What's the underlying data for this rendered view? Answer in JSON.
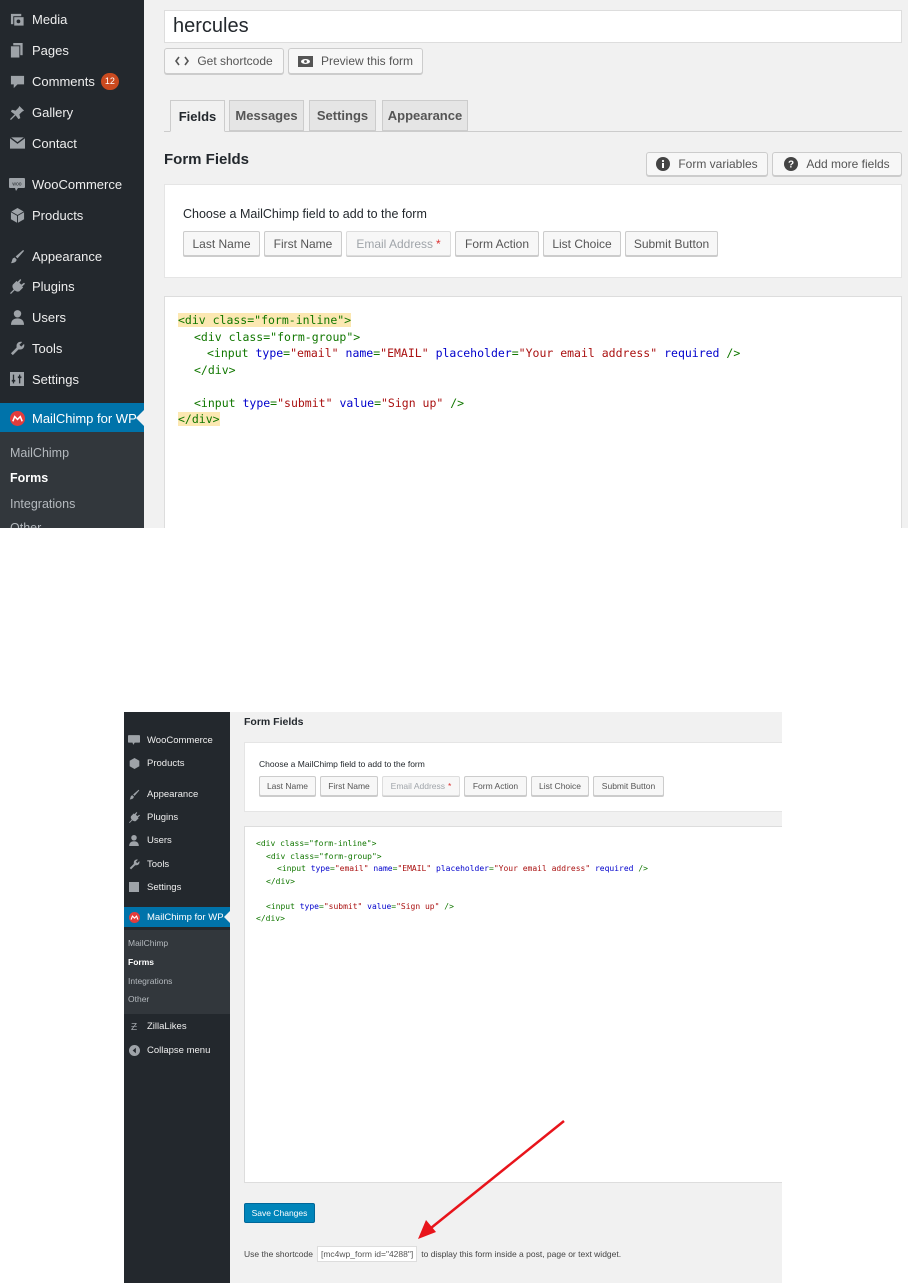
{
  "colors": {
    "sidebar_bg": "#23282d",
    "active_menu": "#0073aa",
    "primary_button": "#0085ba",
    "badge": "#ca4a1f",
    "arrow": "#e8141b"
  },
  "sidebar": {
    "items": [
      {
        "label": "Media",
        "icon": "media-icon"
      },
      {
        "label": "Pages",
        "icon": "pages-icon"
      },
      {
        "label": "Comments",
        "icon": "comments-icon",
        "badge": "12"
      },
      {
        "label": "Gallery",
        "icon": "pin-icon"
      },
      {
        "label": "Contact",
        "icon": "mail-icon"
      },
      {
        "label": "WooCommerce",
        "icon": "woo-icon"
      },
      {
        "label": "Products",
        "icon": "cube-icon"
      },
      {
        "label": "Appearance",
        "icon": "brush-icon"
      },
      {
        "label": "Plugins",
        "icon": "plug-icon"
      },
      {
        "label": "Users",
        "icon": "user-icon"
      },
      {
        "label": "Tools",
        "icon": "wrench-icon"
      },
      {
        "label": "Settings",
        "icon": "settings-icon"
      },
      {
        "label": "MailChimp for WP",
        "icon": "mailchimp-icon"
      }
    ],
    "submenu": [
      "MailChimp",
      "Forms",
      "Integrations",
      "Other"
    ],
    "extra": [
      {
        "label": "ZillaLikes",
        "icon": "zilla-icon"
      },
      {
        "label": "Collapse menu",
        "icon": "collapse-icon"
      }
    ]
  },
  "form": {
    "title": "hercules",
    "get_shortcode": "Get shortcode",
    "preview": "Preview this form"
  },
  "tabs": [
    "Fields",
    "Messages",
    "Settings",
    "Appearance"
  ],
  "fields_section": {
    "title": "Form Fields",
    "form_variables": "Form variables",
    "add_more_fields": "Add more fields",
    "choose_label": "Choose a MailChimp field to add to the form",
    "buttons": [
      "Last Name",
      "First Name",
      "Email Address",
      "Form Action",
      "List Choice",
      "Submit Button"
    ],
    "required_mark": "*"
  },
  "code": {
    "open_div": "<div class=\"form-inline\">",
    "open_group": "<div class=\"form-group\">",
    "input_email": "<input type=\"email\" name=\"EMAIL\" placeholder=\"Your email address\" required />",
    "close_group": "</div>",
    "input_submit": "<input type=\"submit\" value=\"Sign up\" />",
    "close_div": "</div>"
  },
  "footer": {
    "save": "Save Changes",
    "use_prefix": "Use the shortcode",
    "shortcode": "[mc4wp_form id=\"4288\"]",
    "use_suffix": "to display this form inside a post, page or text widget."
  }
}
